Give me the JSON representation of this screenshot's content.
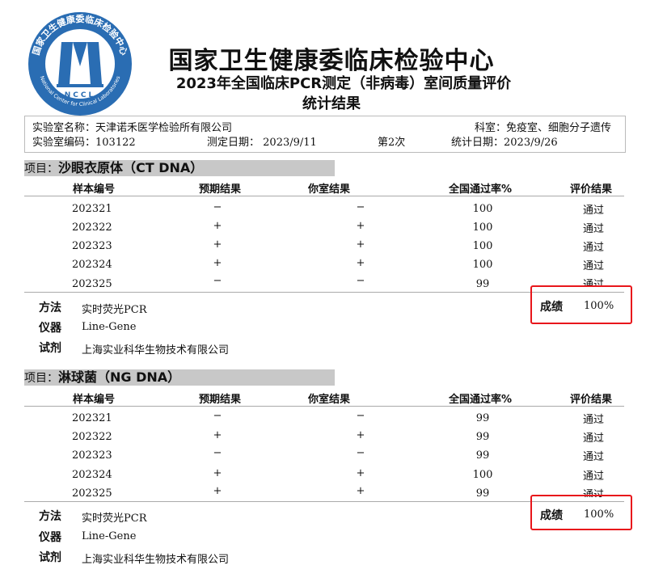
{
  "logo": {
    "ring_text": "国家卫生健康委临床检验中心",
    "ring_text_en": "National Center for Clinical Laboratories",
    "center_text": "NCCL",
    "colors": {
      "ring": "#2a6db3",
      "inner": "#ffffff",
      "figure": "#2a6db3"
    }
  },
  "header": {
    "title": "国家卫生健康委临床检验中心",
    "subtitle": "2023年全国临床PCR测定（非病毒）室间质量评价",
    "subtitle2": "统计结果"
  },
  "lab_info": {
    "name_label": "实验室名称：",
    "name": "天津诺禾医学检验所有限公司",
    "dept_label": "科室：",
    "dept": "免疫室、细胞分子遗传",
    "code_label": "实验室编码：",
    "code": "103122",
    "test_date_label": "测定日期：",
    "test_date": "2023/9/11",
    "round": "第2次",
    "stat_date_label": "统计日期：",
    "stat_date": "2023/9/26"
  },
  "columns": {
    "sample": "样本编号",
    "expected": "预期结果",
    "yours": "你室结果",
    "pass_rate": "全国通过率%",
    "evaluation": "评价结果"
  },
  "sections": [
    {
      "prefix": "项目：",
      "name": "沙眼衣原体（CT DNA）",
      "rows": [
        {
          "sample": "202321",
          "expected": "−",
          "yours": "−",
          "rate": "100",
          "eval": "通过"
        },
        {
          "sample": "202322",
          "expected": "+",
          "yours": "+",
          "rate": "100",
          "eval": "通过"
        },
        {
          "sample": "202323",
          "expected": "+",
          "yours": "+",
          "rate": "100",
          "eval": "通过"
        },
        {
          "sample": "202324",
          "expected": "+",
          "yours": "+",
          "rate": "100",
          "eval": "通过"
        },
        {
          "sample": "202325",
          "expected": "−",
          "yours": "−",
          "rate": "99",
          "eval": "通过"
        }
      ],
      "method_label": "方法",
      "method": "实时荧光PCR",
      "instrument_label": "仪器",
      "instrument": "Line-Gene",
      "reagent_label": "试剂",
      "reagent": "上海实业科华生物技术有限公司",
      "score_label": "成绩",
      "score": "100%"
    },
    {
      "prefix": "项目：",
      "name": "淋球菌（NG DNA）",
      "rows": [
        {
          "sample": "202321",
          "expected": "−",
          "yours": "−",
          "rate": "99",
          "eval": "通过"
        },
        {
          "sample": "202322",
          "expected": "+",
          "yours": "+",
          "rate": "99",
          "eval": "通过"
        },
        {
          "sample": "202323",
          "expected": "−",
          "yours": "−",
          "rate": "99",
          "eval": "通过"
        },
        {
          "sample": "202324",
          "expected": "+",
          "yours": "+",
          "rate": "100",
          "eval": "通过"
        },
        {
          "sample": "202325",
          "expected": "+",
          "yours": "+",
          "rate": "99",
          "eval": "通过"
        }
      ],
      "method_label": "方法",
      "method": "实时荧光PCR",
      "instrument_label": "仪器",
      "instrument": "Line-Gene",
      "reagent_label": "试剂",
      "reagent": "上海实业科华生物技术有限公司",
      "score_label": "成绩",
      "score": "100%"
    }
  ],
  "highlight_color": "#e8161b"
}
